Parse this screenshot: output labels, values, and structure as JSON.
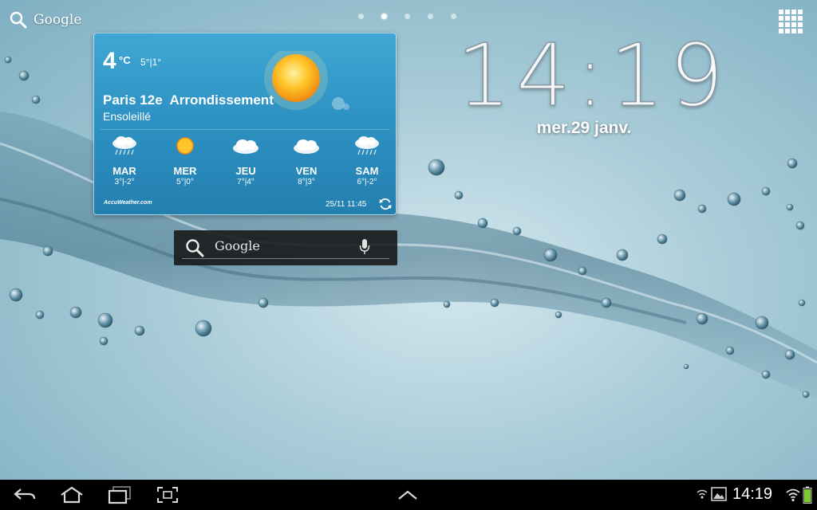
{
  "home": {
    "top_search_label": "Google",
    "pages": [
      false,
      true,
      false,
      false,
      false
    ]
  },
  "clock": {
    "time": "14:19",
    "date": "mer.29 janv."
  },
  "weather": {
    "temperature": "4",
    "unit": "°C",
    "hi_lo": "5°|1°",
    "location": "Paris 12e  Arrondissement",
    "condition": "Ensoleillé",
    "forecast": [
      {
        "day": "MAR",
        "range": "3°|-2°",
        "icon": "rain-cloud-icon"
      },
      {
        "day": "MER",
        "range": "5°|0°",
        "icon": "sun-icon"
      },
      {
        "day": "JEU",
        "range": "7°|4°",
        "icon": "cloud-icon"
      },
      {
        "day": "VEN",
        "range": "8°|3°",
        "icon": "cloud-icon"
      },
      {
        "day": "SAM",
        "range": "6°|-2°",
        "icon": "rain-cloud-icon"
      }
    ],
    "brand": "AccuWeather.com",
    "updated": "25/11 11:45"
  },
  "search_widget": {
    "label": "Google"
  },
  "status_bar": {
    "time": "14:19"
  },
  "colors": {
    "widget_blue": "#2e93c4",
    "nav_bar": "#000000",
    "battery_green": "#7ec832"
  }
}
